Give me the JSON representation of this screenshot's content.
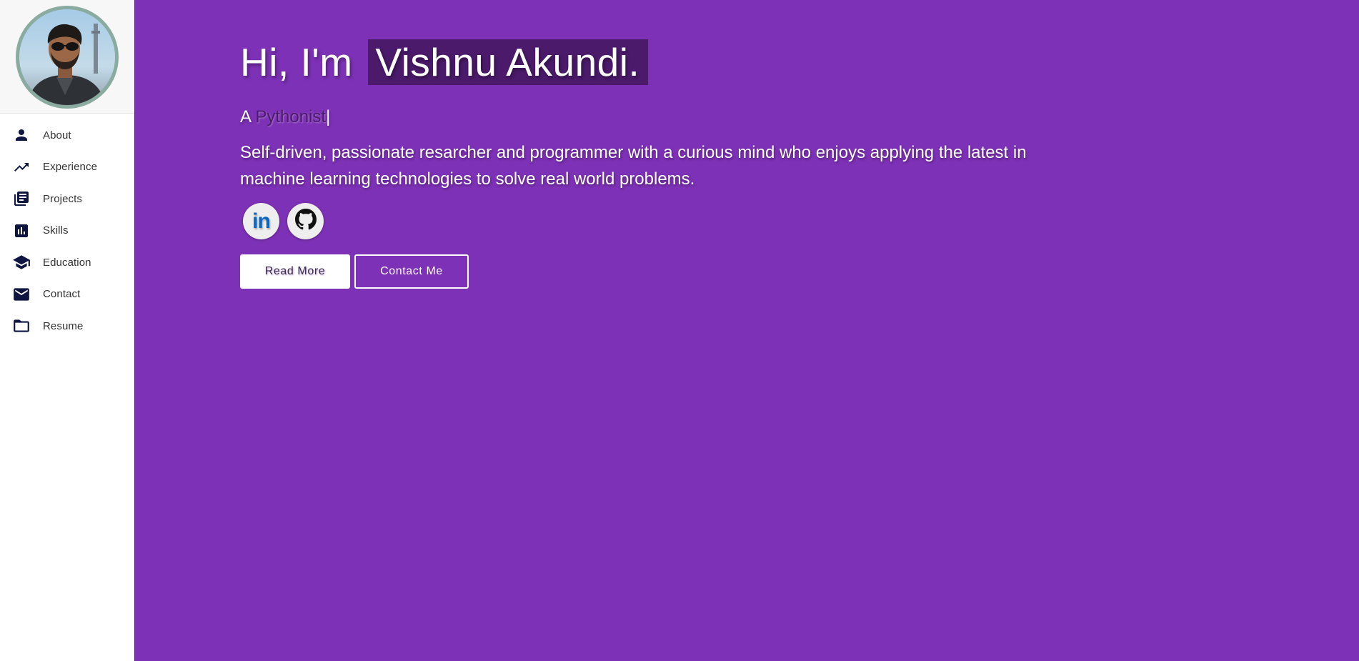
{
  "sidebar": {
    "avatar_alt": "Profile photo",
    "items": [
      {
        "label": "About",
        "icon": "person-icon"
      },
      {
        "label": "Experience",
        "icon": "trending-up-icon"
      },
      {
        "label": "Projects",
        "icon": "library-books-icon"
      },
      {
        "label": "Skills",
        "icon": "bar-chart-icon"
      },
      {
        "label": "Education",
        "icon": "school-icon"
      },
      {
        "label": "Contact",
        "icon": "mail-icon"
      },
      {
        "label": "Resume",
        "icon": "folder-icon"
      }
    ]
  },
  "hero": {
    "greeting": "Hi, I'm",
    "name": "Vishnu Akundi.",
    "typed_prefix": "A",
    "typed_role": "Pythonist",
    "typed_cursor": "|",
    "tagline": "Self-driven, passionate resarcher and programmer with a curious mind who enjoys applying the latest in machine learning technologies to solve real world problems.",
    "social": {
      "linkedin_label": "in",
      "github_icon": "github-icon"
    },
    "buttons": {
      "read_more": "Read More",
      "contact_me": "Contact Me"
    }
  },
  "colors": {
    "main_bg": "#7d31b6",
    "name_highlight": "#4b1a6b",
    "sidebar_bg": "#ffffff",
    "icon_color": "#0d1540",
    "linkedin_blue": "#0a66c2"
  }
}
